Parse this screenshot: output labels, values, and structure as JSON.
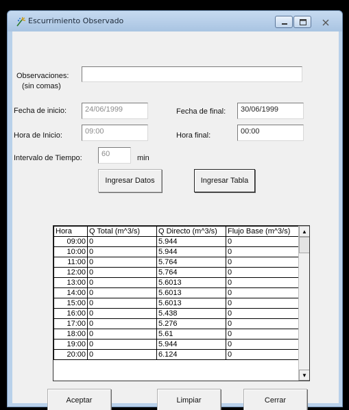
{
  "window": {
    "title": "Escurrimiento Observado",
    "icon": "rainfall-app-icon"
  },
  "form": {
    "observaciones_label": "Observaciones:",
    "observaciones_hint": "(sin comas)",
    "observaciones_value": "",
    "fecha_inicio_label": "Fecha de inicio:",
    "fecha_inicio_value": "24/06/1999",
    "fecha_final_label": "Fecha de final:",
    "fecha_final_value": "30/06/1999",
    "hora_inicio_label": "Hora de Inicio:",
    "hora_inicio_value": "09:00",
    "hora_final_label": "Hora final:",
    "hora_final_value": "00:00",
    "intervalo_label": "Intervalo de Tiempo:",
    "intervalo_value": "60",
    "intervalo_unit": "min"
  },
  "buttons": {
    "ingresar_datos": "Ingresar Datos",
    "ingresar_tabla": "Ingresar Tabla",
    "aceptar": "Aceptar",
    "limpiar": "Limpiar",
    "cerrar": "Cerrar"
  },
  "table": {
    "headers": [
      "Hora",
      "Q Total (m^3/s)",
      "Q Directo (m^3/s)",
      "Flujo Base  (m^3/s)"
    ],
    "rows": [
      [
        "09:00",
        "0",
        "5.944",
        "0"
      ],
      [
        "10:00",
        "0",
        "5.944",
        "0"
      ],
      [
        "11:00",
        "0",
        "5.764",
        "0"
      ],
      [
        "12:00",
        "0",
        "5.764",
        "0"
      ],
      [
        "13:00",
        "0",
        "5.6013",
        "0"
      ],
      [
        "14:00",
        "0",
        "5.6013",
        "0"
      ],
      [
        "15:00",
        "0",
        "5.6013",
        "0"
      ],
      [
        "16:00",
        "0",
        "5.438",
        "0"
      ],
      [
        "17:00",
        "0",
        "5.276",
        "0"
      ],
      [
        "18:00",
        "0",
        "5.61",
        "0"
      ],
      [
        "19:00",
        "0",
        "5.944",
        "0"
      ],
      [
        "20:00",
        "0",
        "6.124",
        "0"
      ]
    ]
  }
}
